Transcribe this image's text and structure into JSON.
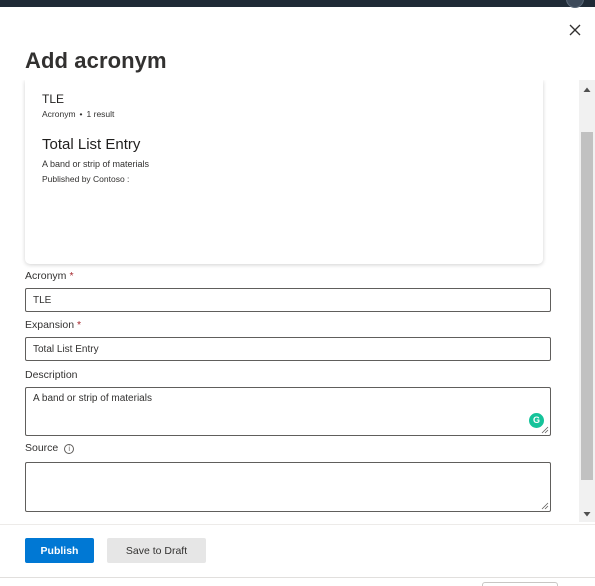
{
  "panel": {
    "title": "Add acronym"
  },
  "preview": {
    "term": "TLE",
    "type_label": "Acronym",
    "separator": "•",
    "result_count": "1 result",
    "expansion": "Total List Entry",
    "description": "A band or strip of materials",
    "published_by": "Published by Contoso :"
  },
  "form": {
    "acronym": {
      "label": "Acronym",
      "required_mark": "*",
      "value": "TLE"
    },
    "expansion": {
      "label": "Expansion",
      "required_mark": "*",
      "value": "Total List Entry"
    },
    "description": {
      "label": "Description",
      "value": "A band or strip of materials"
    },
    "source": {
      "label": "Source",
      "info_glyph": "i",
      "value": ""
    }
  },
  "footer": {
    "publish_label": "Publish",
    "save_draft_label": "Save to Draft"
  },
  "colors": {
    "primary": "#0078d4",
    "required": "#a4262c",
    "grammarly": "#15c39a"
  },
  "icons": {
    "close": "close-icon",
    "info": "info-icon",
    "grammarly": "grammarly-icon"
  }
}
